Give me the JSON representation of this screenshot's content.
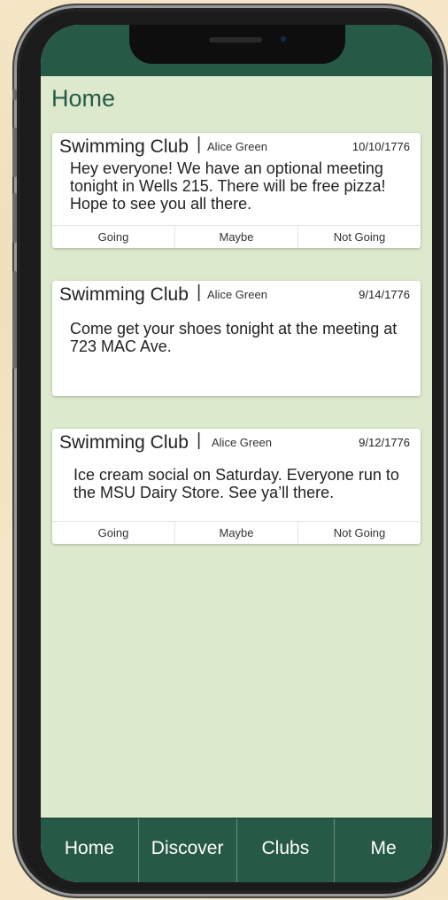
{
  "page": {
    "title": "Home"
  },
  "posts": [
    {
      "club": "Swimming Club",
      "separator": "|",
      "author": "Alice Green",
      "date": "10/10/1776",
      "body": "Hey everyone! We have an optional meeting tonight in Wells 215. There will be free pizza! Hope to see you all there.",
      "rsvp": {
        "going": "Going",
        "maybe": "Maybe",
        "not_going": "Not Going"
      }
    },
    {
      "club": "Swimming Club",
      "separator": "|",
      "author": "Alice Green",
      "date": "9/14/1776",
      "body": "Come get your shoes tonight at the meeting at 723 MAC Ave."
    },
    {
      "club": "Swimming Club",
      "separator": "|",
      "author": "Alice Green",
      "date": "9/12/1776",
      "body": "Ice cream social on Saturday. Everyone run to the MSU Dairy Store. See ya’ll there.",
      "rsvp": {
        "going": "Going",
        "maybe": "Maybe",
        "not_going": "Not Going"
      }
    }
  ],
  "tabs": [
    "Home",
    "Discover",
    "Clubs",
    "Me"
  ],
  "colors": {
    "accent": "#275a46",
    "screen_bg": "#dde9cc",
    "card_bg": "#ffffff"
  }
}
